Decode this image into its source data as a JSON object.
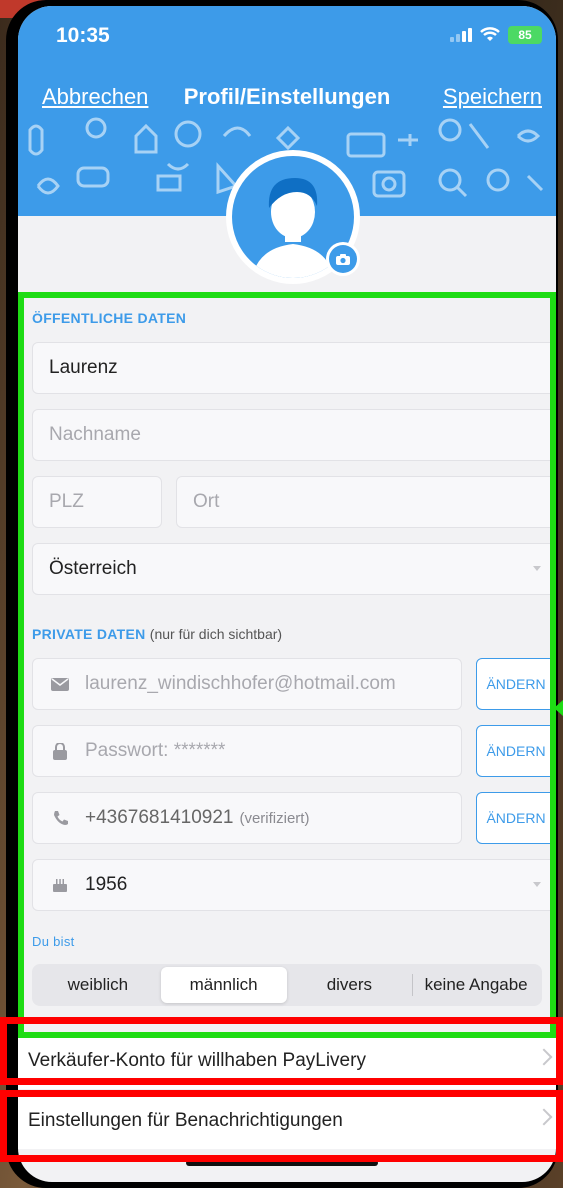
{
  "status_bar": {
    "time": "10:35",
    "battery": "85"
  },
  "nav": {
    "cancel": "Abbrechen",
    "title": "Profil/Einstellungen",
    "save": "Speichern"
  },
  "public": {
    "heading": "ÖFFENTLICHE DATEN",
    "first_name": "Laurenz",
    "last_name_placeholder": "Nachname",
    "zip_placeholder": "PLZ",
    "city_placeholder": "Ort",
    "country": "Österreich"
  },
  "private": {
    "heading": "PRIVATE DATEN",
    "heading_note": "(nur für dich sichtbar)",
    "email": "laurenz_windischhofer@hotmail.com",
    "password": "Passwort: *******",
    "phone": "+4367681410921",
    "phone_note": "(verifiziert)",
    "birth_year": "1956",
    "change_label": "ÄNDERN"
  },
  "gender": {
    "label": "Du bist",
    "options": [
      "weiblich",
      "männlich",
      "divers",
      "keine Angabe"
    ],
    "selected": "männlich"
  },
  "links": {
    "paylivery": "Verkäufer-Konto für willhaben PayLivery",
    "notifications": "Einstellungen für Benachrichtigungen"
  },
  "colors": {
    "accent": "#3d9be9",
    "highlight_green": "#1edc14",
    "highlight_red": "#ff0000"
  }
}
